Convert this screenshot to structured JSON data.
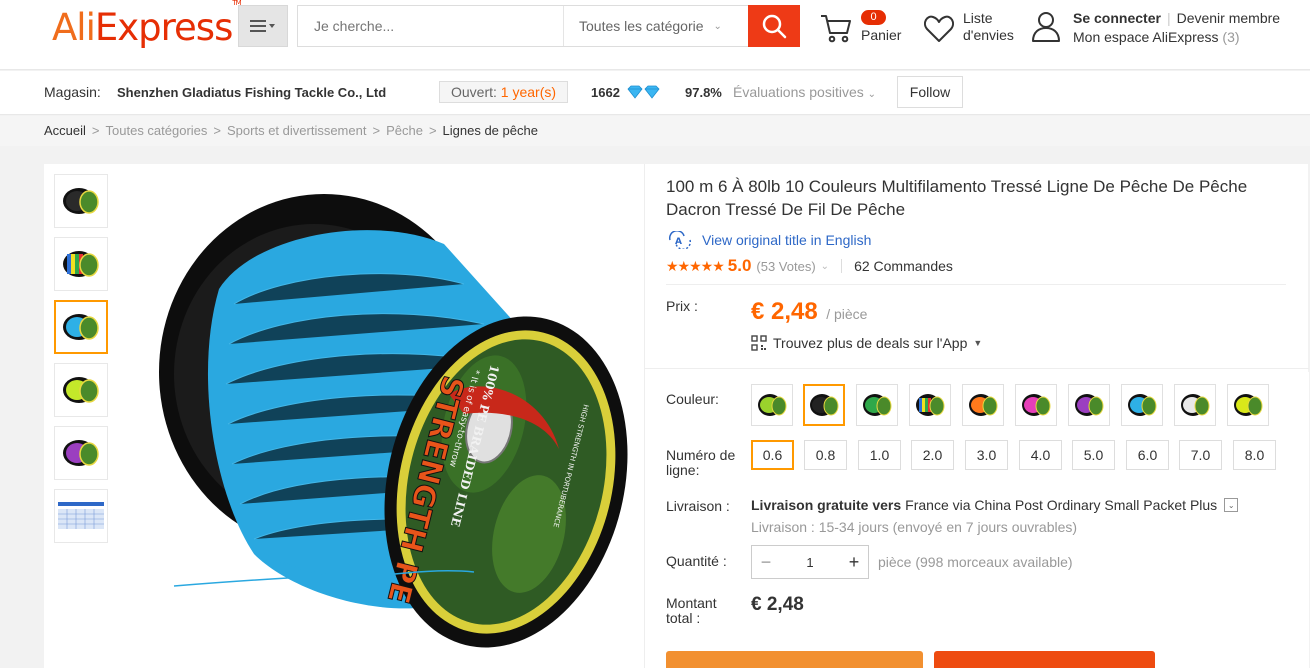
{
  "header": {
    "logo_part1": "Ali",
    "logo_part2": "Express",
    "logo_tm": "TM",
    "search_placeholder": "Je cherche...",
    "category_select": "Toutes les catégorie",
    "cart_count": "0",
    "cart_label": "Panier",
    "wishlist_label_1": "Liste",
    "wishlist_label_2": "d'envies",
    "sign_in": "Se connecter",
    "join": "Devenir membre",
    "my_account": "Mon espace AliExpress",
    "my_account_count": "(3)"
  },
  "store": {
    "label": "Magasin:",
    "name": "Shenzhen Gladiatus Fishing Tackle Co., Ltd",
    "open_label": "Ouvert:",
    "open_value": "1 year(s)",
    "score": "1662",
    "positive_pct": "97.8%",
    "positive_label": "Évaluations positives",
    "follow": "Follow"
  },
  "breadcrumb": [
    "Accueil",
    "Toutes catégories",
    "Sports et divertissement",
    "Pêche",
    "Lignes de pêche"
  ],
  "product": {
    "title": "100 m 6 À 80lb 10 Couleurs Multifilamento Tressé Ligne De Pêche De Pêche Dacron Tressé De Fil De Pêche",
    "view_original": "View original title in English",
    "rating_value": "5.0",
    "votes": "(53 Votes)",
    "orders": "62 Commandes",
    "price_label": "Prix :",
    "price": "€ 2,48",
    "price_unit": "/ pièce",
    "deals": "Trouvez plus de deals sur l'App",
    "color_label": "Couleur:",
    "size_label_1": "Numéro de",
    "size_label_2": "ligne:",
    "sizes": [
      "0.6",
      "0.8",
      "1.0",
      "2.0",
      "3.0",
      "4.0",
      "5.0",
      "6.0",
      "7.0",
      "8.0"
    ],
    "selected_size": "0.6",
    "colors": [
      "#9ad22c",
      "#222222",
      "#2fa84a",
      "multi",
      "#ff7a1c",
      "#e63fb8",
      "#9b3fc0",
      "#2eb0e6",
      "#e8e8e8",
      "#d9e81a"
    ],
    "selected_color_index": 1,
    "shipping_label": "Livraison :",
    "shipping_bold": "Livraison gratuite vers",
    "shipping_rest": "France via China Post Ordinary Small Packet Plus",
    "shipping_time": "Livraison : 15-34 jours (envoyé en 7 jours ouvrables)",
    "qty_label": "Quantité :",
    "qty_value": "1",
    "qty_note": "pièce (998 morceaux available)",
    "total_label_1": "Montant",
    "total_label_2": "total :",
    "total_value": "€ 2,48"
  },
  "gallery": {
    "thumbs": [
      "#222222",
      "multi",
      "#2eb0e6",
      "#c4e82a",
      "#9b3fc0",
      "chart"
    ],
    "active_thumb": 2,
    "reel_label_big": "STRENGTH PE",
    "reel_label_small": "100% PE BRAIDED LINE",
    "reel_tagline": "* It is of easy-to-throw",
    "reel_rim_text": "HIGH STRENGTH IN PORTUBERANCE"
  }
}
